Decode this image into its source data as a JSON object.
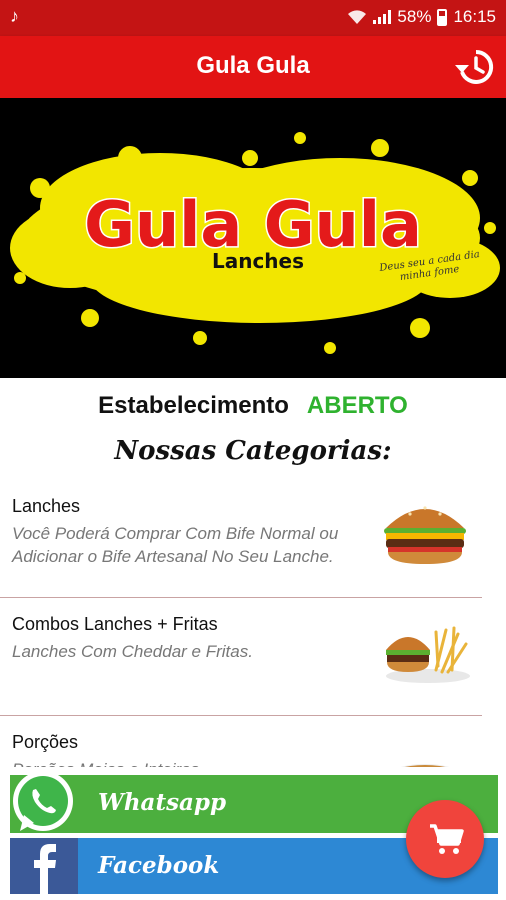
{
  "status_bar": {
    "time": "16:15",
    "battery": "58%",
    "battery_level": 0.58
  },
  "app_bar": {
    "title": "Gula Gula",
    "history_icon": "history-icon"
  },
  "banner": {
    "brand": "Gula Gula",
    "subtitle": "Lanches",
    "tagline": "Deus seu a cada dia minha fome"
  },
  "establishment": {
    "label": "Estabelecimento",
    "state": "ABERTO",
    "state_color": "#2fb22f"
  },
  "categories_title": "Nossas Categorias:",
  "categories": [
    {
      "title": "Lanches",
      "description": "Você Poderá Comprar Com Bife Normal ou Adicionar o Bife Artesanal No Seu Lanche.",
      "icon": "burger-icon"
    },
    {
      "title": "Combos Lanches + Fritas",
      "description": "Lanches Com Cheddar e Fritas.",
      "icon": "combo-icon"
    },
    {
      "title": "Porções",
      "description": "Porções Meias e Inteiras",
      "icon": "portion-icon"
    }
  ],
  "social": {
    "whatsapp_label": "Whatsapp",
    "facebook_label": "Facebook"
  },
  "colors": {
    "primary": "#e21414",
    "status_bar": "#c41414",
    "whatsapp": "#4caf3e",
    "facebook": "#2d88d4",
    "fab": "#f0443c"
  }
}
